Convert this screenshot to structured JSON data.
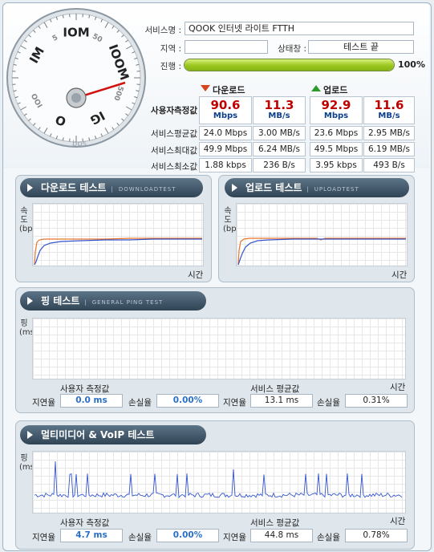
{
  "header": {
    "service_name_label": "서비스명 :",
    "service_name": "QOOK 인터넷 라이트 FTTH",
    "region_label": "지역 :",
    "region": "",
    "status_label": "상태창 :",
    "status": "테스트 끝",
    "progress_label": "진행 :",
    "progress_percent": 100,
    "progress_text": "100%"
  },
  "gauge": {
    "tick_labels": [
      "IM",
      "5",
      "IOM",
      "50",
      "IOOM",
      "500",
      "IG",
      "O",
      "IOO"
    ],
    "unit": "bps",
    "needle_value_mbps": 90
  },
  "stats": {
    "download_label": "다운로드",
    "upload_label": "업로드",
    "measured_label": "사용자측정값",
    "measured": {
      "down_mbps": "90.6",
      "down_mbps_unit": "Mbps",
      "down_mbs": "11.3",
      "down_mbs_unit": "MB/s",
      "up_mbps": "92.9",
      "up_mbps_unit": "Mbps",
      "up_mbs": "11.6",
      "up_mbs_unit": "MB/s"
    },
    "rows": [
      {
        "label": "서비스평균값",
        "down_a": "24.0 Mbps",
        "down_b": "3.00 MB/s",
        "up_a": "23.6 Mbps",
        "up_b": "2.95 MB/s"
      },
      {
        "label": "서비스최대값",
        "down_a": "49.9 Mbps",
        "down_b": "6.24 MB/s",
        "up_a": "49.5 Mbps",
        "up_b": "6.19 MB/s"
      },
      {
        "label": "서비스최소값",
        "down_a": "1.88 kbps",
        "down_b": "236 B/s",
        "up_a": "3.95 kbps",
        "up_b": "493 B/s"
      }
    ]
  },
  "download_test": {
    "title": "다운로드 테스트",
    "subtitle": "DOWNLOADTEST",
    "ylabel": "속도 (bps)",
    "xlabel": "시간"
  },
  "upload_test": {
    "title": "업로드 테스트",
    "subtitle": "UPLOADTEST",
    "ylabel": "속도 (bps)",
    "xlabel": "시간"
  },
  "ping_test": {
    "title": "핑 테스트",
    "subtitle": "GENERAL PING TEST",
    "ylabel": "핑 (ms)",
    "xlabel": "시간",
    "user_label": "사용자 측정값",
    "service_label": "서비스 평균값",
    "latency_label": "지연율",
    "loss_label": "손실율",
    "user_latency": "0.0 ms",
    "user_loss": "0.00%",
    "service_latency": "13.1 ms",
    "service_loss": "0.31%"
  },
  "voip_test": {
    "title": "멀티미디어 & VoIP 테스트",
    "ylabel": "핑 (ms)",
    "xlabel": "시간",
    "user_label": "사용자 측정값",
    "service_label": "서비스 평균값",
    "latency_label": "지연율",
    "loss_label": "손실율",
    "user_latency": "4.7 ms",
    "user_loss": "0.00%",
    "service_latency": "44.8 ms",
    "service_loss": "0.78%"
  },
  "colors": {
    "measured_red": "#c00000",
    "unit_blue": "#0c3f8c",
    "series_orange": "#e8742a",
    "series_blue": "#3355cc",
    "down_arrow": "#d9431f",
    "up_arrow": "#2f9a2f"
  }
}
